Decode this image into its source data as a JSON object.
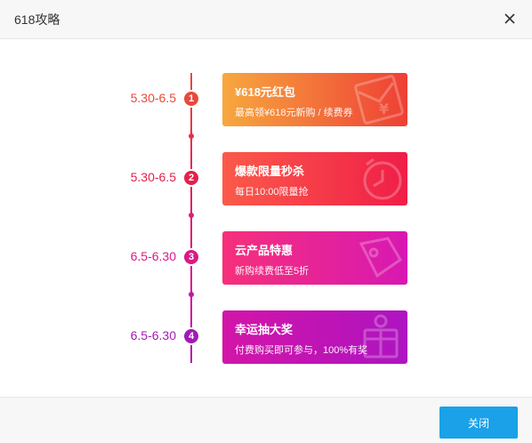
{
  "dialog": {
    "title": "618攻略",
    "close_icon": "close-icon",
    "close_button": "关闭"
  },
  "stages": [
    {
      "date": "5.30-6.5",
      "number": "1",
      "title": "¥618元红包",
      "subtitle": "最高领¥618元新购 / 续费券",
      "icon": "red-envelope-yen-icon",
      "color": "#e8493b",
      "gradient": [
        "#f7a83f",
        "#ee3f35"
      ]
    },
    {
      "date": "5.30-6.5",
      "number": "2",
      "title": "爆款限量秒杀",
      "subtitle": "每日10:00限量抢",
      "icon": "alarm-clock-icon",
      "color": "#e4204a",
      "gradient": [
        "#fb5a4a",
        "#f01e48"
      ]
    },
    {
      "date": "6.5-6.30",
      "number": "3",
      "title": "云产品特惠",
      "subtitle": "新购续费低至5折",
      "icon": "price-tag-icon",
      "color": "#d91a86",
      "gradient": [
        "#f6307b",
        "#d718b2"
      ]
    },
    {
      "date": "6.5-6.30",
      "number": "4",
      "title": "幸运抽大奖",
      "subtitle": "付费购买即可参与，100%有奖",
      "icon": "gift-box-icon",
      "color": "#a319b6",
      "gradient": [
        "#d315a8",
        "#ad14c1"
      ]
    }
  ]
}
